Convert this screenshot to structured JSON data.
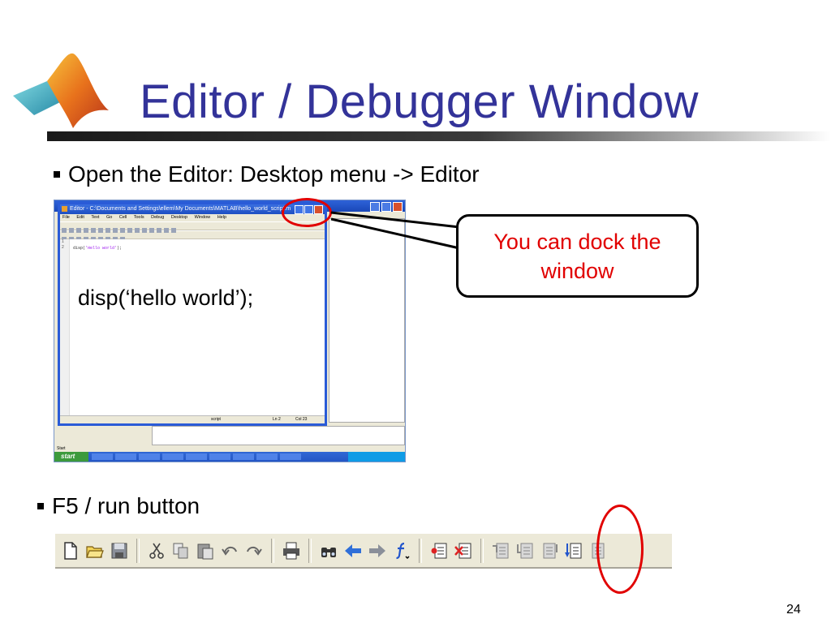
{
  "slide": {
    "title": "Editor / Debugger Window",
    "page_number": "24"
  },
  "bullets": {
    "open_editor": "Open the Editor:  Desktop menu -> Editor",
    "run": "F5 /  run button"
  },
  "code_sample": "disp(‘hello world’);",
  "callout": {
    "line1": "You can dock the",
    "line2": "window"
  },
  "editor_screenshot": {
    "window_title": "Editor - C:\\Documents and Settings\\ellem\\My Documents\\MATLAB\\hello_world_script.m",
    "menu": [
      "File",
      "Edit",
      "Text",
      "Go",
      "Cell",
      "Tools",
      "Debug",
      "Desktop",
      "Window",
      "Help"
    ],
    "line_numbers": [
      "1",
      "2"
    ],
    "code_line": "disp(",
    "code_string": "'Hello world'",
    "code_end": ");",
    "status_mode": "script",
    "status_ln": "Ln  2",
    "status_col": "Col  23",
    "start_label": "Start",
    "start_button": "start"
  },
  "toolbar_icons": [
    "new-file-icon",
    "open-folder-icon",
    "save-icon",
    "cut-icon",
    "copy-icon",
    "paste-icon",
    "undo-icon",
    "redo-icon",
    "print-icon",
    "find-icon",
    "back-arrow-icon",
    "forward-arrow-icon",
    "function-icon",
    "set-breakpoint-icon",
    "clear-breakpoint-icon",
    "step-icon",
    "step-in-icon",
    "step-out-icon",
    "run-icon",
    "exit-debug-icon"
  ],
  "colors": {
    "title": "#333399",
    "highlight": "#e10000"
  }
}
